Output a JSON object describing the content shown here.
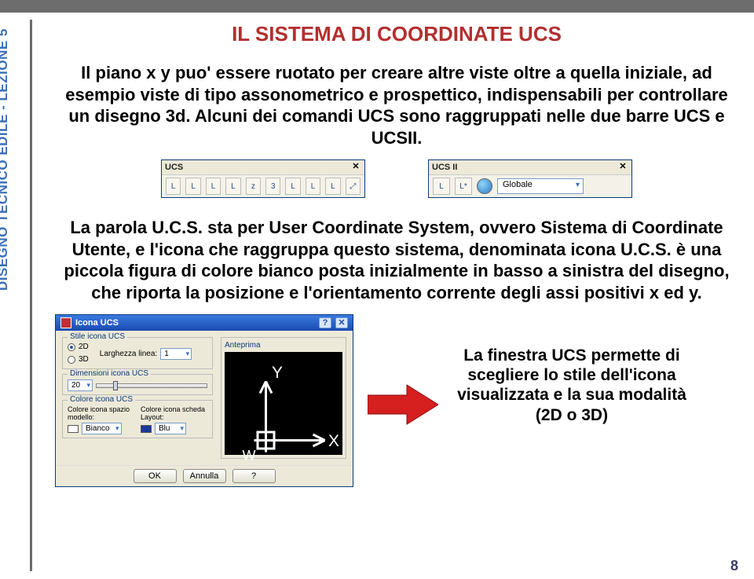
{
  "sidebar": {
    "label": "DISEGNO TECNICO EDILE - LEZIONE 5"
  },
  "title": "IL SISTEMA DI COORDINATE UCS",
  "paragraph1": "Il piano x y puo' essere ruotato per creare altre viste oltre a quella iniziale, ad esempio viste di tipo assonometrico e prospettico, indispensabili per controllare un disegno 3d. Alcuni dei comandi UCS sono raggruppati nelle due barre UCS e UCSII.",
  "paragraph2": "La parola U.C.S. sta per User Coordinate System, ovvero Sistema di Coordinate Utente, e l'icona che raggruppa questo sistema, denominata icona U.C.S. è una piccola figura di colore bianco posta inizialmente in basso a sinistra del disegno, che riporta la posizione e l'orientamento corrente degli assi positivi x ed y.",
  "callout": "La finestra UCS permette di scegliere lo stile dell'icona visualizzata e la sua modalità (2D o 3D)",
  "page_number": "8",
  "toolbar1": {
    "title": "UCS"
  },
  "toolbar2": {
    "title": "UCS II",
    "dropdown": "Globale"
  },
  "dialog": {
    "title": "Icona UCS",
    "style_legend": "Stile icona UCS",
    "opt_2d": "2D",
    "opt_3d": "3D",
    "line_width_label": "Larghezza linea:",
    "line_width_value": "1",
    "size_legend": "Dimensioni icona UCS",
    "size_value": "20",
    "color_legend": "Colore icona UCS",
    "model_color_label": "Colore icona spazio modello:",
    "model_color_value": "Bianco",
    "layout_color_label": "Colore icona scheda Layout:",
    "layout_color_value": "Blu",
    "preview_legend": "Anteprima",
    "btn_ok": "OK",
    "btn_cancel": "Annulla",
    "btn_help": "?"
  }
}
